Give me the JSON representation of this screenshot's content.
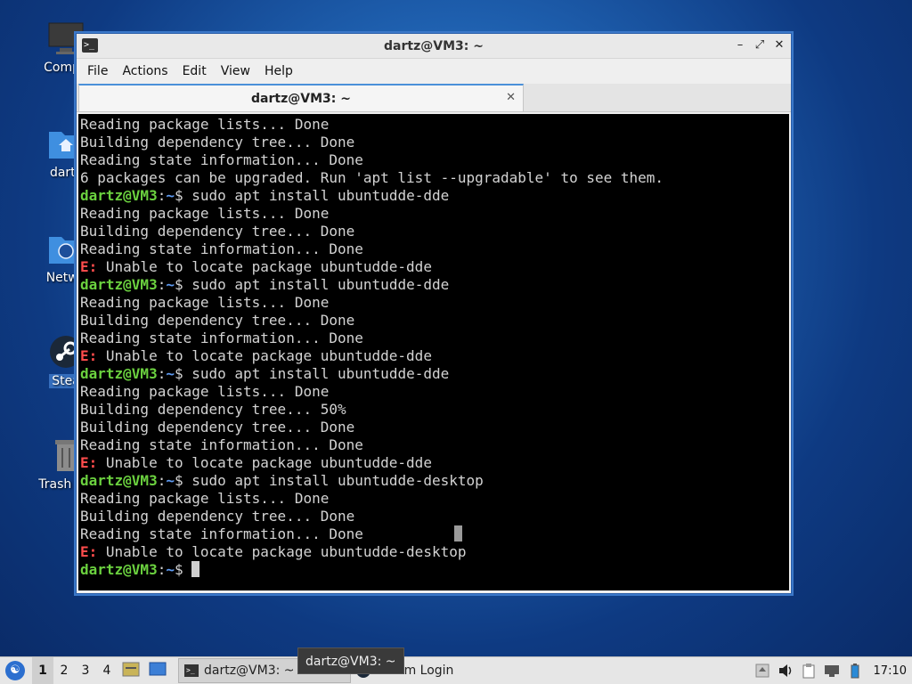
{
  "desktop": {
    "icons": [
      {
        "label": "Compu",
        "icon": "computer-icon"
      },
      {
        "label": "dartz",
        "icon": "home-folder-icon"
      },
      {
        "label": "Netwo",
        "icon": "network-folder-icon"
      },
      {
        "label": "Stea",
        "icon": "steam-icon"
      },
      {
        "label": "Trash (Er",
        "icon": "trash-icon"
      }
    ]
  },
  "window": {
    "title": "dartz@VM3: ~",
    "menu": [
      "File",
      "Actions",
      "Edit",
      "View",
      "Help"
    ],
    "tab_title": "dartz@VM3: ~",
    "colors": {
      "prompt": "#6bd13f",
      "path": "#5f9bf2",
      "error": "#ff4c4c",
      "text": "#d3d3d3",
      "bg": "#000000"
    }
  },
  "terminal": {
    "lines": [
      {
        "type": "text",
        "text": "Reading package lists... Done"
      },
      {
        "type": "text",
        "text": "Building dependency tree... Done"
      },
      {
        "type": "text",
        "text": "Reading state information... Done"
      },
      {
        "type": "text",
        "text": "6 packages can be upgraded. Run 'apt list --upgradable' to see them."
      },
      {
        "type": "cmd",
        "user": "dartz@VM3",
        "path": "~",
        "cmd": " sudo apt install ubuntudde-dde"
      },
      {
        "type": "text",
        "text": "Reading package lists... Done"
      },
      {
        "type": "text",
        "text": "Building dependency tree... Done"
      },
      {
        "type": "text",
        "text": "Reading state information... Done"
      },
      {
        "type": "err",
        "label": "E:",
        "text": " Unable to locate package ubuntudde-dde"
      },
      {
        "type": "cmd",
        "user": "dartz@VM3",
        "path": "~",
        "cmd": " sudo apt install ubuntudde-dde"
      },
      {
        "type": "text",
        "text": "Reading package lists... Done"
      },
      {
        "type": "text",
        "text": "Building dependency tree... Done"
      },
      {
        "type": "text",
        "text": "Reading state information... Done"
      },
      {
        "type": "err",
        "label": "E:",
        "text": " Unable to locate package ubuntudde-dde"
      },
      {
        "type": "cmd",
        "user": "dartz@VM3",
        "path": "~",
        "cmd": " sudo apt install ubuntudde-dde"
      },
      {
        "type": "text",
        "text": "Reading package lists... Done"
      },
      {
        "type": "text",
        "text": "Building dependency tree... 50%"
      },
      {
        "type": "text",
        "text": "Building dependency tree... Done"
      },
      {
        "type": "text",
        "text": "Reading state information... Done"
      },
      {
        "type": "err",
        "label": "E:",
        "text": " Unable to locate package ubuntudde-dde"
      },
      {
        "type": "cmd",
        "user": "dartz@VM3",
        "path": "~",
        "cmd": " sudo apt install ubuntudde-desktop"
      },
      {
        "type": "text",
        "text": "Reading package lists... Done"
      },
      {
        "type": "text",
        "text": "Building dependency tree... Done"
      },
      {
        "type": "text",
        "text": "Reading state information... Done",
        "ghost": true
      },
      {
        "type": "err",
        "label": "E:",
        "text": " Unable to locate package ubuntudde-desktop"
      },
      {
        "type": "cmd",
        "user": "dartz@VM3",
        "path": "~",
        "cmd": " ",
        "cursor": true
      }
    ]
  },
  "taskbar": {
    "workspaces": [
      "1",
      "2",
      "3",
      "4"
    ],
    "active_workspace": "1",
    "tasks": [
      {
        "label": "dartz@VM3: ~",
        "active": true
      },
      {
        "label": "Steam Login",
        "active": false
      }
    ],
    "tooltip": "dartz@VM3: ~",
    "clock": "17:10"
  }
}
